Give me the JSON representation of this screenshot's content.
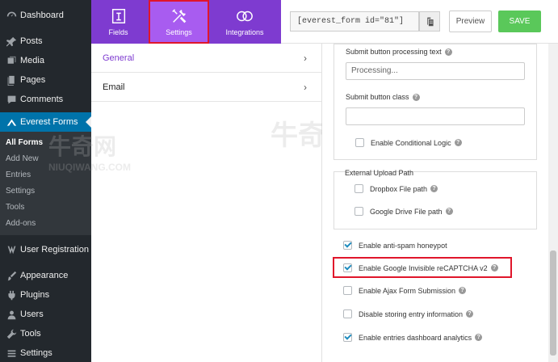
{
  "sidebar": {
    "items": [
      {
        "label": "Dashboard",
        "icon": "dashboard-icon"
      },
      {
        "label": "Posts",
        "icon": "pin-icon"
      },
      {
        "label": "Media",
        "icon": "media-icon"
      },
      {
        "label": "Pages",
        "icon": "pages-icon"
      },
      {
        "label": "Comments",
        "icon": "comment-icon"
      },
      {
        "label": "Everest Forms",
        "icon": "everest-forms-icon"
      }
    ],
    "submenu": [
      "All Forms",
      "Add New",
      "Entries",
      "Settings",
      "Tools",
      "Add-ons"
    ],
    "items_after": [
      {
        "label": "User Registration",
        "icon": "user-registration-icon"
      },
      {
        "label": "Appearance",
        "icon": "brush-icon"
      },
      {
        "label": "Plugins",
        "icon": "plugin-icon"
      },
      {
        "label": "Users",
        "icon": "users-icon"
      },
      {
        "label": "Tools",
        "icon": "wrench-icon"
      },
      {
        "label": "Settings",
        "icon": "settings-icon"
      }
    ]
  },
  "topbar": {
    "tabs": [
      {
        "label": "Fields",
        "icon": "fields-icon"
      },
      {
        "label": "Settings",
        "icon": "tools-icon"
      },
      {
        "label": "Integrations",
        "icon": "integrations-icon"
      }
    ],
    "shortcode": "[everest_form id=\"81\"]",
    "preview_label": "Preview",
    "save_label": "SAVE"
  },
  "settings_nav": [
    {
      "label": "General"
    },
    {
      "label": "Email"
    }
  ],
  "panel": {
    "processing_label": "Submit button processing text",
    "processing_value": "Processing...",
    "class_label": "Submit button class",
    "class_value": "",
    "conditional_logic": "Enable Conditional Logic",
    "upload_title": "External Upload Path",
    "dropbox": "Dropbox File path",
    "gdrive": "Google Drive File path",
    "options": [
      {
        "label": "Enable anti-spam honeypot",
        "checked": true
      },
      {
        "label": "Enable Google Invisible reCAPTCHA v2",
        "checked": true
      },
      {
        "label": "Enable Ajax Form Submission",
        "checked": false
      },
      {
        "label": "Disable storing entry information",
        "checked": false
      },
      {
        "label": "Enable entries dashboard analytics",
        "checked": true
      }
    ]
  },
  "watermark": {
    "logo": "牛奇网",
    "url": "NIUQIWANG.COM"
  },
  "colors": {
    "accent": "#7e3bd0",
    "save": "#5ac85a",
    "wp_active": "#0073aa",
    "highlight": "#e0162b"
  }
}
